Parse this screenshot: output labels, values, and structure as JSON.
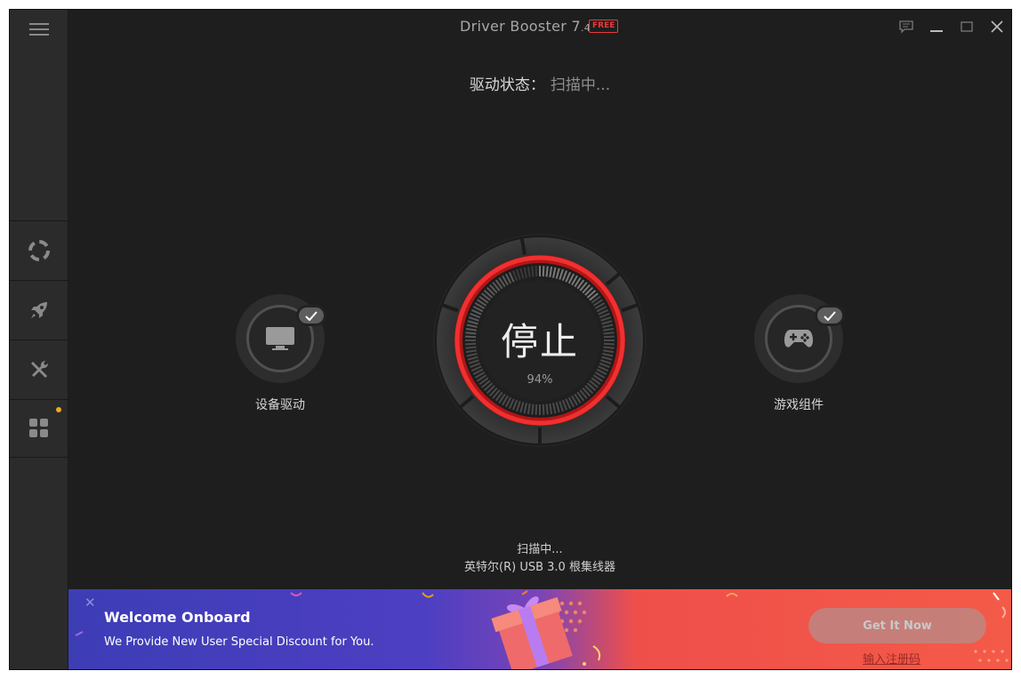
{
  "app": {
    "title": "Driver Booster 7",
    "version": ".4",
    "badge": "FREE"
  },
  "status": {
    "label": "驱动状态：",
    "value": "扫描中..."
  },
  "dial": {
    "button_label": "停止",
    "progress_text": "94%",
    "progress": 0.94
  },
  "left_module": {
    "label": "设备驱动",
    "icon": "monitor-icon"
  },
  "right_module": {
    "label": "游戏组件",
    "icon": "gamepad-icon"
  },
  "scan": {
    "status": "扫描中...",
    "current_item": "英特尔(R) USB 3.0 根集线器"
  },
  "sidebar": {
    "items": [
      {
        "icon": "lifebuoy-icon"
      },
      {
        "icon": "rocket-icon"
      },
      {
        "icon": "tools-icon"
      },
      {
        "icon": "apps-grid-icon",
        "has_notification": true
      }
    ]
  },
  "banner": {
    "title": "Welcome Onboard",
    "subtitle": "We Provide New User Special Discount for You.",
    "button_label": "Get It Now",
    "link_label": "输入注册码"
  },
  "colors": {
    "accent_red": "#ea2e2e",
    "background": "#1e1e1e",
    "sidebar": "#2b2b2b",
    "notification_dot": "#f2a623"
  }
}
